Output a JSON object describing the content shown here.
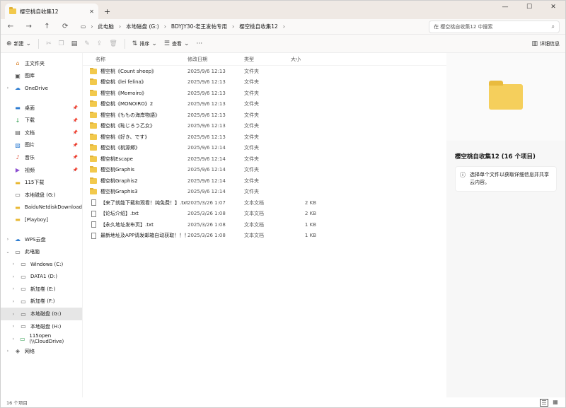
{
  "window": {
    "tab_title": "樱空桃自收集12",
    "tab_close": "✕",
    "new_tab": "+",
    "min": "—",
    "max": "☐",
    "close": "✕"
  },
  "nav": {
    "back": "←",
    "forward": "→",
    "up": "↑",
    "refresh": "⟳",
    "pc_icon": "▭",
    "breadcrumb": [
      "此电脑",
      "本地磁盘 (G:)",
      "BDYJY30-老王发帖专用",
      "樱空桃自收集12"
    ],
    "search_placeholder": "在 樱空桃自收集12 中搜索"
  },
  "toolbar": {
    "new": "新建",
    "sort": "排序",
    "view": "查看",
    "more": "···",
    "details": "详细信息"
  },
  "sidebar": [
    {
      "label": "主文件夹",
      "icon": "home-icon",
      "glyph": "⌂",
      "chev": "",
      "pin": false
    },
    {
      "label": "图库",
      "icon": "gallery-icon",
      "glyph": "▣",
      "chev": "",
      "pin": false
    },
    {
      "label": "OneDrive",
      "icon": "cloud-icon",
      "glyph": "☁",
      "chev": "›",
      "pin": false
    },
    {
      "gap": true
    },
    {
      "label": "桌面",
      "icon": "desktop-icon",
      "glyph": "▬",
      "chev": "",
      "pin": true
    },
    {
      "label": "下载",
      "icon": "download-icon",
      "glyph": "↓",
      "chev": "",
      "pin": true
    },
    {
      "label": "文档",
      "icon": "documents-icon",
      "glyph": "▤",
      "chev": "",
      "pin": true
    },
    {
      "label": "图片",
      "icon": "pictures-icon",
      "glyph": "▨",
      "chev": "",
      "pin": true
    },
    {
      "label": "音乐",
      "icon": "music-icon",
      "glyph": "♪",
      "chev": "",
      "pin": true
    },
    {
      "label": "视频",
      "icon": "videos-icon",
      "glyph": "▶",
      "chev": "",
      "pin": true
    },
    {
      "label": "115下载",
      "icon": "folder-icon",
      "glyph": "▬",
      "chev": "",
      "pin": false
    },
    {
      "label": "本地磁盘 (G:)",
      "icon": "drive-icon",
      "glyph": "▭",
      "chev": "",
      "pin": false
    },
    {
      "label": "BaiduNetdiskDownload",
      "icon": "folder-icon",
      "glyph": "▬",
      "chev": "",
      "pin": false
    },
    {
      "label": "[Playboy]",
      "icon": "folder-icon",
      "glyph": "▬",
      "chev": "",
      "pin": false
    },
    {
      "gap": true
    },
    {
      "label": "WPS云盘",
      "icon": "cloud-icon",
      "glyph": "☁",
      "chev": "›",
      "pin": false
    },
    {
      "label": "此电脑",
      "icon": "pc-icon",
      "glyph": "▭",
      "chev": "⌄",
      "pin": false
    },
    {
      "label": "Windows (C:)",
      "icon": "drive-icon",
      "glyph": "▭",
      "chev": "›",
      "pin": false,
      "indent": true
    },
    {
      "label": "DATA1 (D:)",
      "icon": "drive-icon",
      "glyph": "▭",
      "chev": "›",
      "pin": false,
      "indent": true
    },
    {
      "label": "新加卷 (E:)",
      "icon": "drive-icon",
      "glyph": "▭",
      "chev": "›",
      "pin": false,
      "indent": true
    },
    {
      "label": "新加卷 (F:)",
      "icon": "drive-icon",
      "glyph": "▭",
      "chev": "›",
      "pin": false,
      "indent": true
    },
    {
      "label": "本地磁盘 (G:)",
      "icon": "drive-icon",
      "glyph": "▭",
      "chev": "›",
      "pin": false,
      "indent": true,
      "selected": true
    },
    {
      "label": "本地磁盘 (H:)",
      "icon": "drive-icon",
      "glyph": "▭",
      "chev": "›",
      "pin": false,
      "indent": true
    },
    {
      "label": "115open (\\\\CloudDrive)",
      "icon": "network-drive-icon",
      "glyph": "▭",
      "chev": "›",
      "pin": false,
      "indent": true
    },
    {
      "label": "网络",
      "icon": "network-icon",
      "glyph": "◈",
      "chev": "›",
      "pin": false
    }
  ],
  "columns": {
    "name": "名称",
    "date": "修改日期",
    "type": "类型",
    "size": "大小"
  },
  "files": [
    {
      "name": "樱空桃《Count sheep》",
      "date": "2025/9/6 12:13",
      "type": "文件夹",
      "size": "",
      "folder": true
    },
    {
      "name": "樱空桃《lei felina》",
      "date": "2025/9/6 12:13",
      "type": "文件夹",
      "size": "",
      "folder": true
    },
    {
      "name": "樱空桃《Momoiro》",
      "date": "2025/9/6 12:13",
      "type": "文件夹",
      "size": "",
      "folder": true
    },
    {
      "name": "樱空桃《MONOIRO》2",
      "date": "2025/9/6 12:13",
      "type": "文件夹",
      "size": "",
      "folder": true
    },
    {
      "name": "樱空桃《ももの海岸物語》",
      "date": "2025/9/6 12:13",
      "type": "文件夹",
      "size": "",
      "folder": true
    },
    {
      "name": "樱空桃《恥じろう乙女》",
      "date": "2025/9/6 12:13",
      "type": "文件夹",
      "size": "",
      "folder": true
    },
    {
      "name": "樱空桃《好き、です》",
      "date": "2025/9/6 12:13",
      "type": "文件夹",
      "size": "",
      "folder": true
    },
    {
      "name": "樱空桃《桃源郷》",
      "date": "2025/9/6 12:14",
      "type": "文件夹",
      "size": "",
      "folder": true
    },
    {
      "name": "樱空桃Escape",
      "date": "2025/9/6 12:14",
      "type": "文件夹",
      "size": "",
      "folder": true
    },
    {
      "name": "樱空桃Graphis",
      "date": "2025/9/6 12:14",
      "type": "文件夹",
      "size": "",
      "folder": true
    },
    {
      "name": "樱空桃Graphis2",
      "date": "2025/9/6 12:14",
      "type": "文件夹",
      "size": "",
      "folder": true
    },
    {
      "name": "樱空桃Graphis3",
      "date": "2025/9/6 12:14",
      "type": "文件夹",
      "size": "",
      "folder": true
    },
    {
      "name": "【来了就能下载和观看！纯免费！】.txt",
      "date": "2025/3/26 1:07",
      "type": "文本文档",
      "size": "2 KB",
      "folder": false
    },
    {
      "name": "【论坛介绍】.txt",
      "date": "2025/3/26 1:08",
      "type": "文本文档",
      "size": "2 KB",
      "folder": false
    },
    {
      "name": "【永久地址发布页】.txt",
      "date": "2025/3/26 1:08",
      "type": "文本文档",
      "size": "1 KB",
      "folder": false
    },
    {
      "name": "最新地址及APP请发邮箱自动获取！！！...",
      "date": "2025/3/26 1:08",
      "type": "文本文档",
      "size": "1 KB",
      "folder": false
    }
  ],
  "detail": {
    "title": "樱空桃自收集12 (16 个项目)",
    "info": "选择单个文件以获取详细信息并共享云内容。"
  },
  "status": {
    "count": "16 个项目"
  }
}
